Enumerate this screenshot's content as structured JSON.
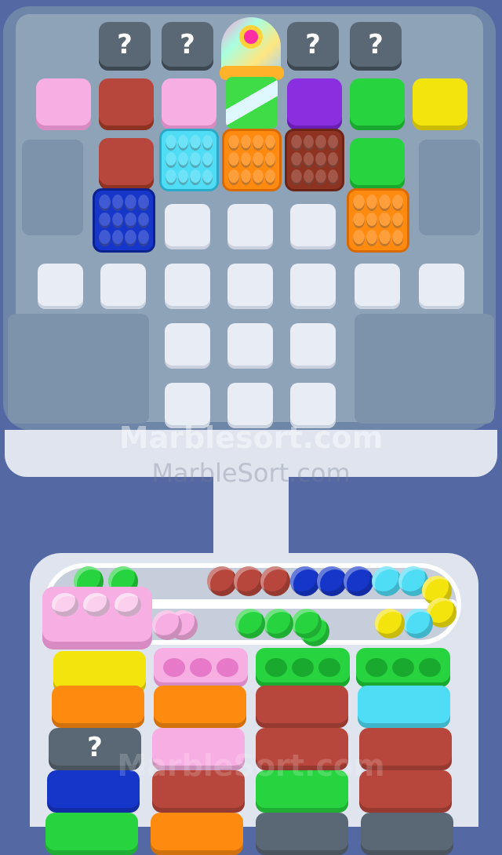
{
  "mystery_label": "?",
  "watermark_1": "Marblesort.com",
  "watermark_2": "MarbleSort.com",
  "colors": {
    "pink": "#f7aee2",
    "brick": "#b7463c",
    "purple": "#8a2fe0",
    "green": "#27d43f",
    "yellow": "#f4e40e",
    "cyan": "#4fdcf5",
    "orange": "#ff8a10",
    "maroon": "#8e3222",
    "blue": "#1536c8"
  },
  "rail_balls": [
    "green",
    "green",
    "empty",
    "empty",
    "empty",
    "brick",
    "brick",
    "brick",
    "blue",
    "blue",
    "blue",
    "cyan",
    "cyan",
    "yellow",
    "yellow",
    "yellow",
    "cyan",
    "pink",
    "pink",
    "green",
    "green",
    "green",
    "green"
  ],
  "columns": [
    {
      "cap": "pink",
      "cap_slots": 3,
      "blocks": [
        "yellow",
        "orange",
        "mystery",
        "blue",
        "green"
      ]
    },
    {
      "cap": "pink",
      "cap_slots": 3,
      "blocks": [
        "orange",
        "pink",
        "brick",
        "orange"
      ]
    },
    {
      "cap": "green",
      "cap_slots": 3,
      "blocks": [
        "brick",
        "brick",
        "green",
        "mystery"
      ]
    },
    {
      "cap": "green",
      "cap_slots": 3,
      "blocks": [
        "cyan",
        "brick",
        "brick",
        "mystery"
      ]
    }
  ]
}
